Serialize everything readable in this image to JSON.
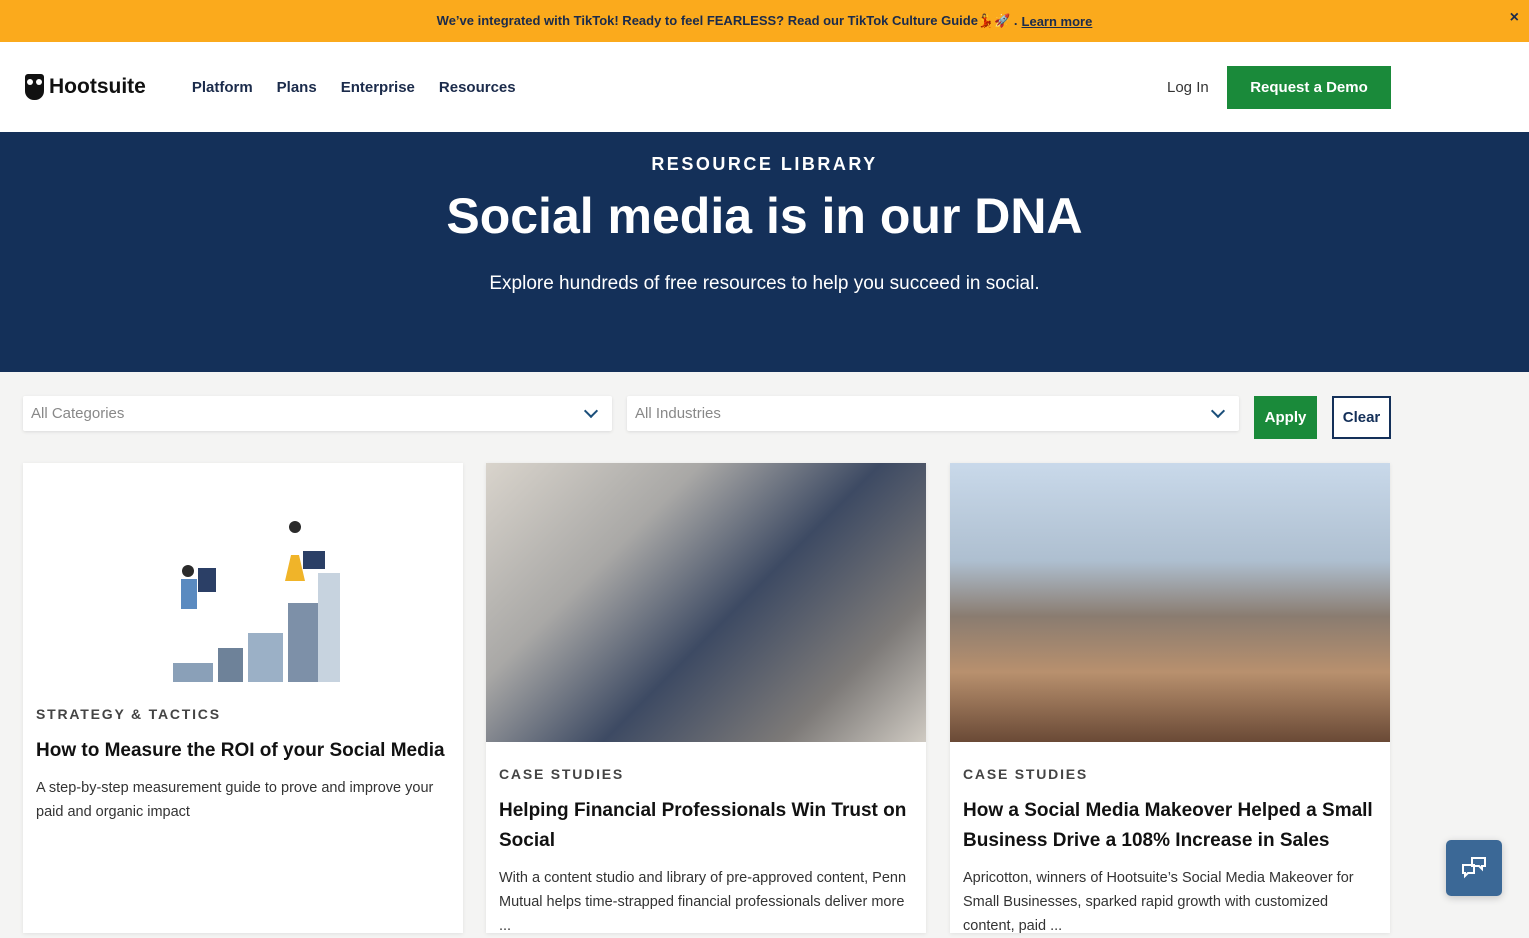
{
  "banner": {
    "text": "We’ve integrated with TikTok! Ready to feel FEARLESS? Read our TikTok Culture Guide💃🚀 .",
    "link": "Learn more",
    "close": "×"
  },
  "nav": {
    "brand": "Hootsuite",
    "items": [
      "Platform",
      "Plans",
      "Enterprise",
      "Resources"
    ],
    "login": "Log In",
    "demo": "Request a Demo"
  },
  "hero": {
    "eyebrow": "RESOURCE LIBRARY",
    "title": "Social media is in our DNA",
    "subtitle": "Explore hundreds of free resources to help you succeed in social."
  },
  "filters": {
    "categories": "All Categories",
    "industries": "All Industries",
    "apply": "Apply",
    "clear": "Clear"
  },
  "cards": [
    {
      "category": "STRATEGY & TACTICS",
      "title": "How to Measure the ROI of your Social Media",
      "desc": "A step-by-step measurement guide to prove and improve your paid and organic impact"
    },
    {
      "category": "CASE STUDIES",
      "title": "Helping Financial Professionals Win Trust on Social",
      "desc": "With a content studio and library of pre-approved content, Penn Mutual helps time-strapped financial professionals deliver more ..."
    },
    {
      "category": "CASE STUDIES",
      "title": "How a Social Media Makeover Helped a Small Business Drive a 108% Increase in Sales",
      "desc": "Apricotton, winners of Hootsuite’s Social Media Makeover for Small Businesses, sparked rapid growth with customized content, paid ..."
    }
  ]
}
